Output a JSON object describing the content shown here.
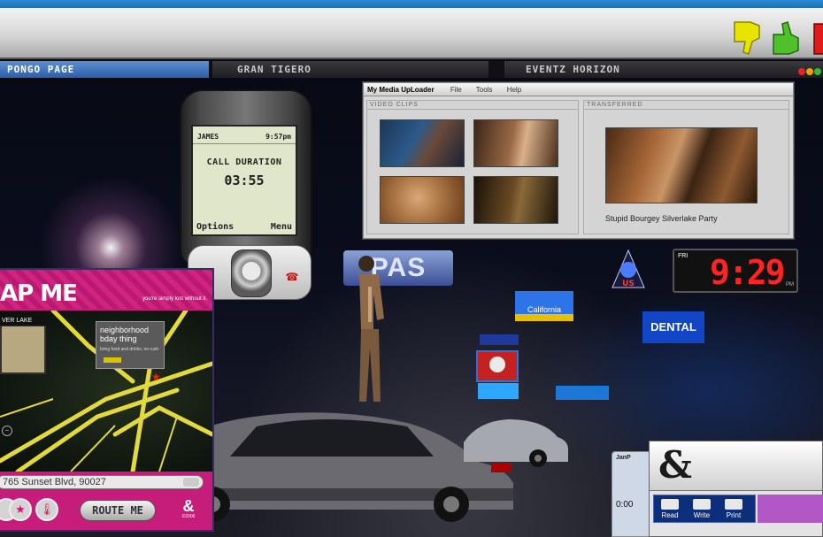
{
  "tabs": [
    {
      "label": "PONGO PAGE",
      "active": true
    },
    {
      "label": "GRAN TIGERO",
      "active": false
    },
    {
      "label": "EVENTZ HORIZON",
      "active": false
    }
  ],
  "toolbar": {
    "icons": [
      "thumbs-down-icon",
      "thumbs-up-icon",
      "stop-icon"
    ]
  },
  "phone": {
    "caller": "JAMES",
    "clock": "9:57pm",
    "title": "CALL DURATION",
    "duration": "03:55",
    "left_softkey": "Options",
    "right_softkey": "Menu"
  },
  "uploader": {
    "title": "My Media UpLoader",
    "menu": [
      "File",
      "Tools",
      "Help"
    ],
    "left_section": "VIDEO CLIPS",
    "right_section": "TRANSFERRED",
    "caption": "Stupid Bourgey Silverlake Party"
  },
  "map": {
    "title": "AP ME",
    "tagline": "you're simply lost without it.",
    "area_label": "VER LAKE",
    "bubble_title": "neighborhood bday thing",
    "bubble_sub": "bring food and drinks, no rush",
    "address": "765 Sunset Blvd, 90027",
    "route_button": "ROUTE ME",
    "brand_year": "©2006"
  },
  "clock": {
    "day": "FRI",
    "time": "9:29",
    "ampm": "PM"
  },
  "signs": {
    "pas": "PAS",
    "cal": "California",
    "dental": "DENTAL"
  },
  "mini_window": {
    "title": "JanP",
    "value": "0:00"
  },
  "doc_window": {
    "tools": [
      "Read",
      "Write",
      "Print"
    ]
  },
  "colors": {
    "accent_blue": "#2b8bd6",
    "map_pink": "#c71d7a",
    "clock_red": "#ff2323"
  }
}
